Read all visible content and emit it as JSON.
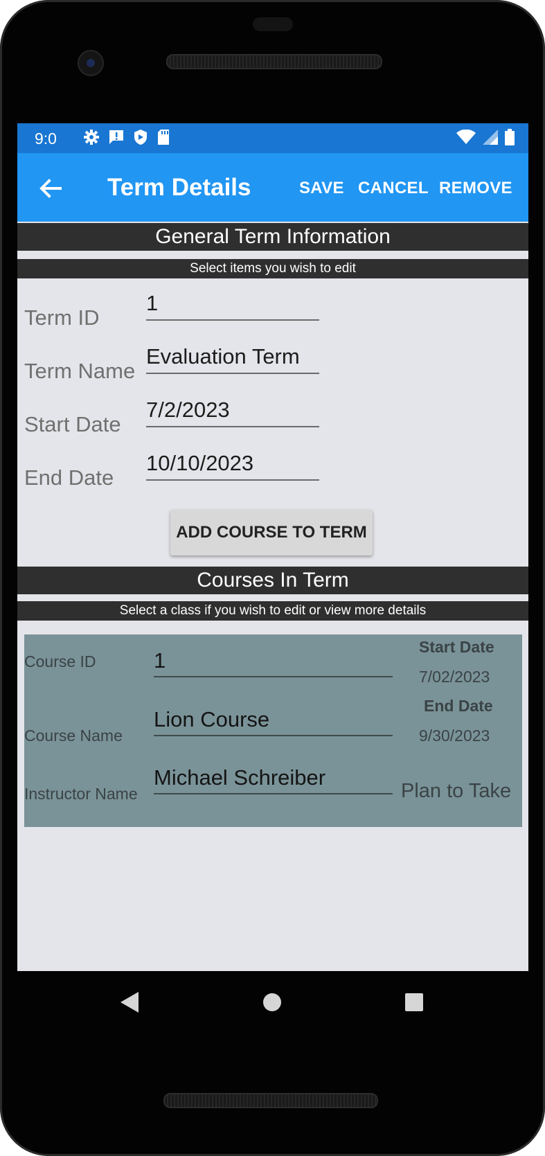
{
  "status_bar": {
    "time": "9:0",
    "left_icons": [
      "gear-icon",
      "alert-icon",
      "shield-icon",
      "sdcard-icon"
    ],
    "right_icons": [
      "wifi-icon",
      "signal-icon",
      "battery-icon"
    ]
  },
  "app_bar": {
    "title": "Term Details",
    "actions": {
      "save": "SAVE",
      "cancel": "CANCEL",
      "remove": "REMOVE"
    },
    "color": "#2196f3"
  },
  "general_section": {
    "title": "General Term Information",
    "subtitle": "Select items you wish to edit",
    "fields": {
      "term_id": {
        "label": "Term ID",
        "value": "1"
      },
      "term_name": {
        "label": "Term Name",
        "value": "Evaluation Term"
      },
      "start_date": {
        "label": "Start Date",
        "value": "7/2/2023"
      },
      "end_date": {
        "label": "End Date",
        "value": "10/10/2023"
      }
    },
    "add_course_button": "ADD COURSE TO TERM"
  },
  "courses_section": {
    "title": "Courses In Term",
    "subtitle": "Select a class if you wish to edit or view more details",
    "courses": [
      {
        "course_id_label": "Course ID",
        "course_id": "1",
        "course_name_label": "Course Name",
        "course_name": "Lion Course",
        "instructor_label": "Instructor Name",
        "instructor": "Michael Schreiber",
        "start_date_label": "Start Date",
        "start_date": "7/02/2023",
        "end_date_label": "End Date",
        "end_date": "9/30/2023",
        "status": "Plan to Take",
        "card_color": "#7a9398"
      }
    ]
  },
  "nav_bar": {
    "buttons": [
      "back-triangle-icon",
      "home-circle-icon",
      "recents-square-icon"
    ]
  }
}
